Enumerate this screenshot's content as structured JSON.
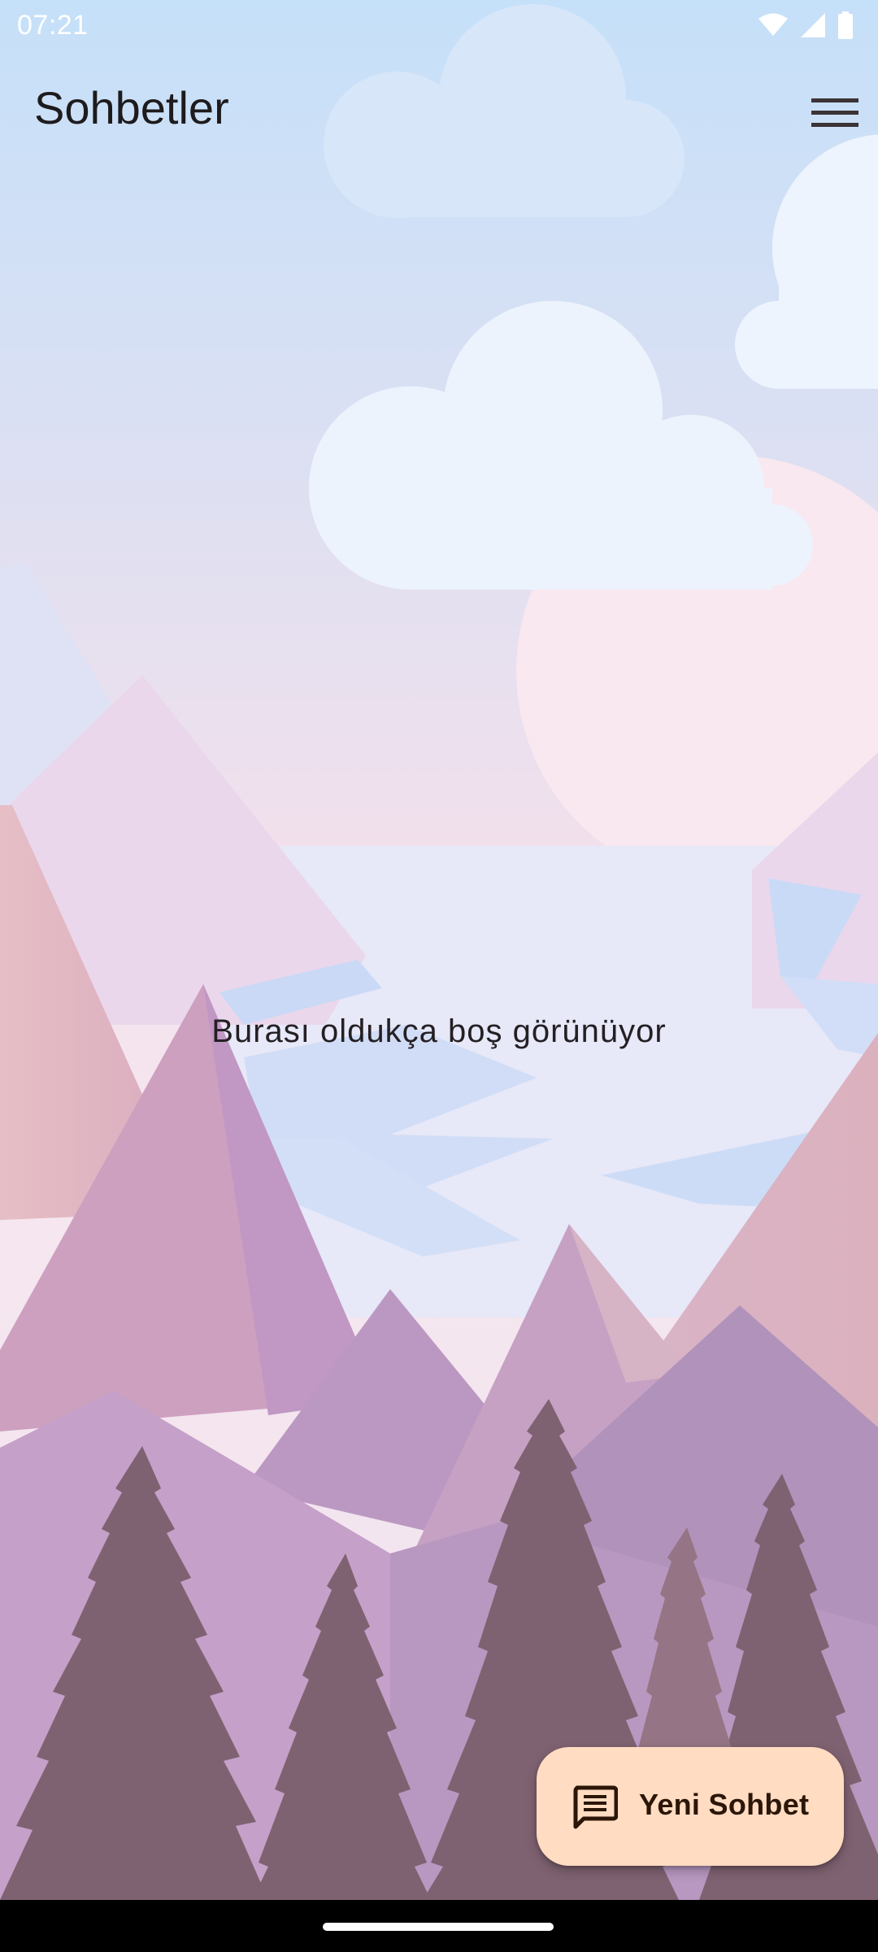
{
  "status_bar": {
    "time": "07:21",
    "icons": [
      "wifi-icon",
      "signal-icon",
      "battery-icon"
    ]
  },
  "app_bar": {
    "title": "Sohbetler",
    "menu_icon": "hamburger-menu-icon"
  },
  "empty_state": {
    "message": "Burası oldukça boş görünüyor"
  },
  "fab": {
    "icon": "chat-message-icon",
    "label": "Yeni Sohbet"
  },
  "theme": {
    "fab_background": "#ffdcc2",
    "sky_top": "#c6e0f8",
    "tree_color": "#7f6271"
  }
}
